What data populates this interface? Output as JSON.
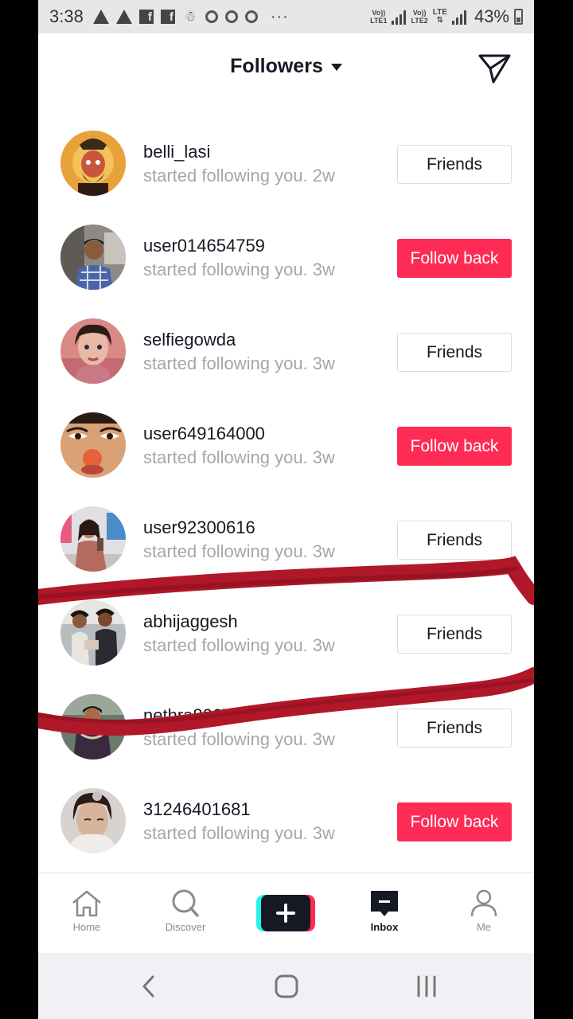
{
  "status_bar": {
    "time": "3:38",
    "more": "···",
    "sim1_top": "Vo))",
    "sim1_bottom": "LTE1",
    "sim2_top": "Vo))",
    "sim2_bottom": "LTE2",
    "sim2_net": "LTE",
    "battery": "43%"
  },
  "header": {
    "title": "Followers"
  },
  "followers": [
    {
      "username": "belli_lasi",
      "activity": "started following you. 2w",
      "button": "Friends",
      "type": "friends"
    },
    {
      "username": "user014654759",
      "activity": "started following you. 3w",
      "button": "Follow back",
      "type": "follow"
    },
    {
      "username": "selfiegowda",
      "activity": "started following you. 3w",
      "button": "Friends",
      "type": "friends"
    },
    {
      "username": "user649164000",
      "activity": "started following you. 3w",
      "button": "Follow back",
      "type": "follow"
    },
    {
      "username": "user92300616",
      "activity": "started following you. 3w",
      "button": "Friends",
      "type": "friends"
    },
    {
      "username": "abhijaggesh",
      "activity": "started following you. 3w",
      "button": "Friends",
      "type": "friends"
    },
    {
      "username": "nethra8067",
      "activity": "started following you. 3w",
      "button": "Friends",
      "type": "friends"
    },
    {
      "username": "31246401681",
      "activity": "started following you. 3w",
      "button": "Follow back",
      "type": "follow"
    }
  ],
  "nav": {
    "home": "Home",
    "discover": "Discover",
    "inbox": "Inbox",
    "me": "Me"
  },
  "colors": {
    "accent": "#fe2c55",
    "cyan": "#25f4ee",
    "text": "#161823",
    "muted": "#a6a6ab",
    "scribble": "#b0182a"
  }
}
